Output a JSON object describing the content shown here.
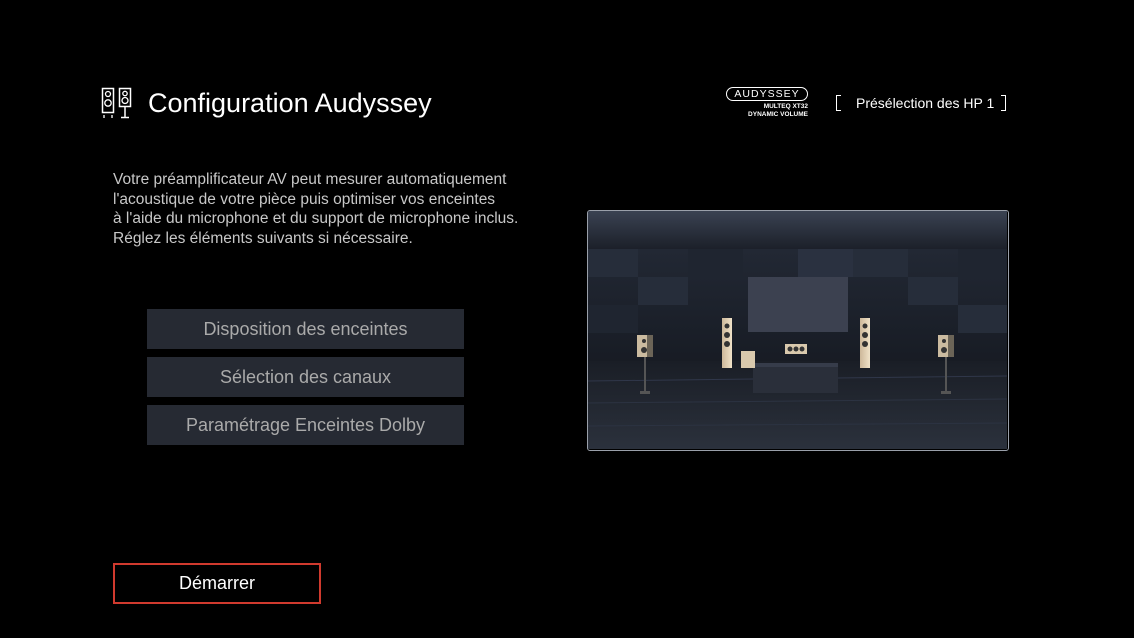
{
  "header": {
    "title": "Configuration Audyssey",
    "icon": "speakers-icon",
    "logo": {
      "brand": "AUDYSSEY",
      "line1": "MULTEQ XT32",
      "line2": "DYNAMIC VOLUME"
    },
    "preset_label": "Présélection des HP 1"
  },
  "description": {
    "lines": [
      "Votre préamplificateur AV peut mesurer automatiquement",
      "l'acoustique de votre pièce puis optimiser vos enceintes",
      "à l'aide du microphone et du support de microphone inclus.",
      "Réglez les éléments suivants si nécessaire."
    ]
  },
  "menu": {
    "items": [
      {
        "label": "Disposition des enceintes"
      },
      {
        "label": "Sélection des canaux"
      },
      {
        "label": "Paramétrage Enceintes Dolby"
      }
    ]
  },
  "start_button": {
    "label": "Démarrer"
  },
  "colors": {
    "background": "#000000",
    "menu_item_bg": "#262a33",
    "menu_item_text": "#aaaaaa",
    "accent_border": "#d03a2e",
    "description_text": "#c8c8c8"
  }
}
